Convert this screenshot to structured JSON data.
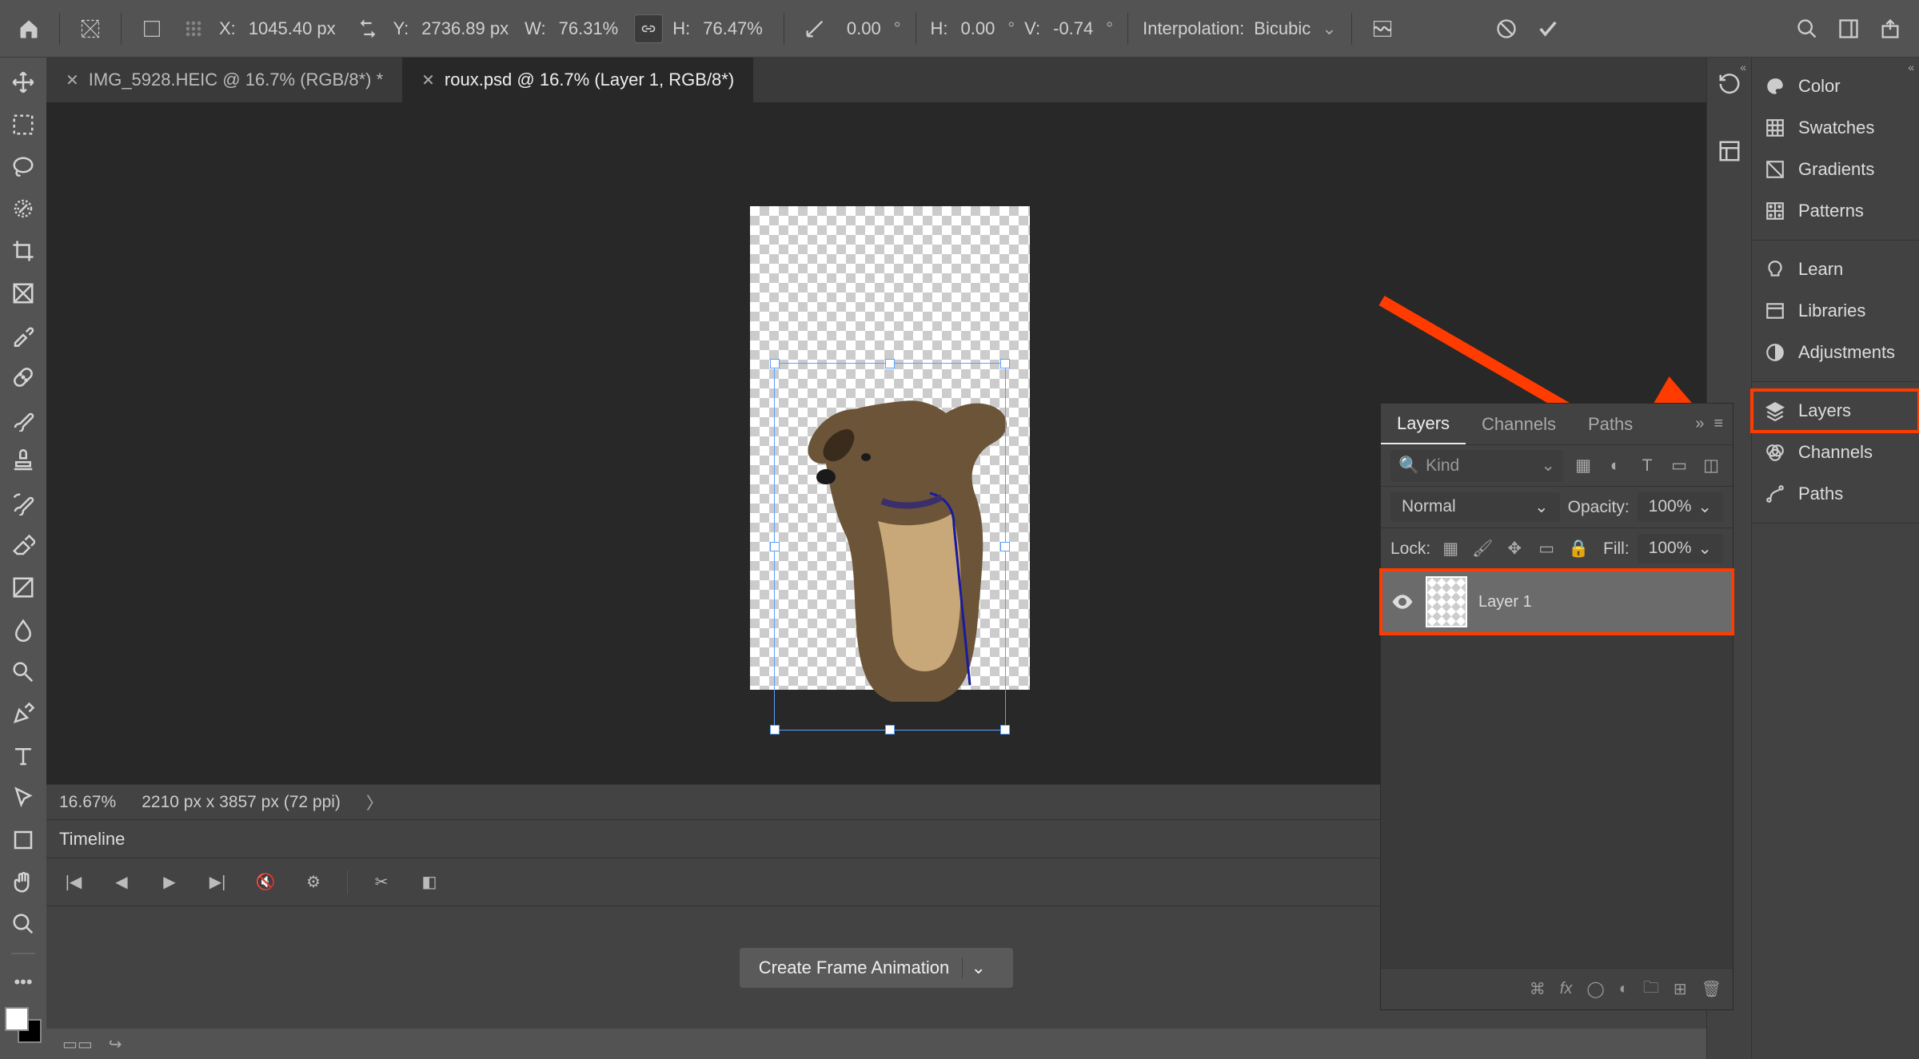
{
  "options_bar": {
    "x_label": "X:",
    "x_value": "1045.40 px",
    "y_label": "Y:",
    "y_value": "2736.89 px",
    "w_label": "W:",
    "w_value": "76.31%",
    "h_label": "H:",
    "h_value": "76.47%",
    "rotate_value": "0.00",
    "shear_h_label": "H:",
    "shear_h_value": "0.00",
    "shear_v_label": "V:",
    "shear_v_value": "-0.74",
    "interp_label": "Interpolation:",
    "interp_value": "Bicubic"
  },
  "tabs": [
    {
      "title": "IMG_5928.HEIC @ 16.7% (RGB/8*) *",
      "active": false
    },
    {
      "title": "roux.psd @ 16.7% (Layer 1, RGB/8*)",
      "active": true
    }
  ],
  "status": {
    "zoom": "16.67%",
    "doc_info": "2210 px x 3857 px (72 ppi)"
  },
  "timeline": {
    "title": "Timeline",
    "create_label": "Create Frame Animation"
  },
  "layers_panel": {
    "tabs": [
      "Layers",
      "Channels",
      "Paths"
    ],
    "kind_placeholder": "Kind",
    "blend_mode": "Normal",
    "opacity_label": "Opacity:",
    "opacity_value": "100%",
    "lock_label": "Lock:",
    "fill_label": "Fill:",
    "fill_value": "100%",
    "layer_name": "Layer 1"
  },
  "right_panel": {
    "groups": [
      [
        "Color",
        "Swatches",
        "Gradients",
        "Patterns"
      ],
      [
        "Learn",
        "Libraries",
        "Adjustments"
      ],
      [
        "Layers",
        "Channels",
        "Paths"
      ]
    ]
  }
}
